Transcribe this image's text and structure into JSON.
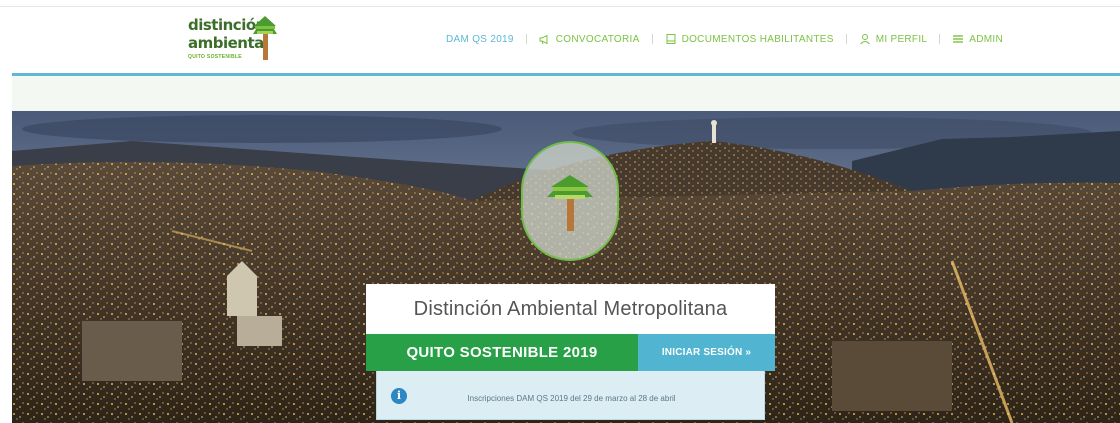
{
  "logo": {
    "line1": "distinción",
    "line2": "ambiental",
    "line3": "QUITO SOSTENIBLE"
  },
  "nav": {
    "items": [
      {
        "label": "DAM QS 2019",
        "icon": ""
      },
      {
        "label": "CONVOCATORIA",
        "icon": "megaphone-icon"
      },
      {
        "label": "DOCUMENTOS HABILITANTES",
        "icon": "document-icon"
      },
      {
        "label": "MI PERFIL",
        "icon": "user-icon"
      },
      {
        "label": "ADMIN",
        "icon": "menu-icon"
      }
    ]
  },
  "hero": {
    "title": "Distinción Ambiental Metropolitana",
    "subtitle": "QUITO SOSTENIBLE 2019",
    "login_label": "INICIAR SESIÓN  »",
    "info_text": "Inscripciones DAM QS 2019 del 29 de marzo al 28 de abril"
  },
  "colors": {
    "nav_green": "#7cc243",
    "nav_active": "#5cb8d6",
    "primary_green": "#27a047",
    "login_blue": "#51b4d0",
    "info_bg": "#dcedf4"
  }
}
